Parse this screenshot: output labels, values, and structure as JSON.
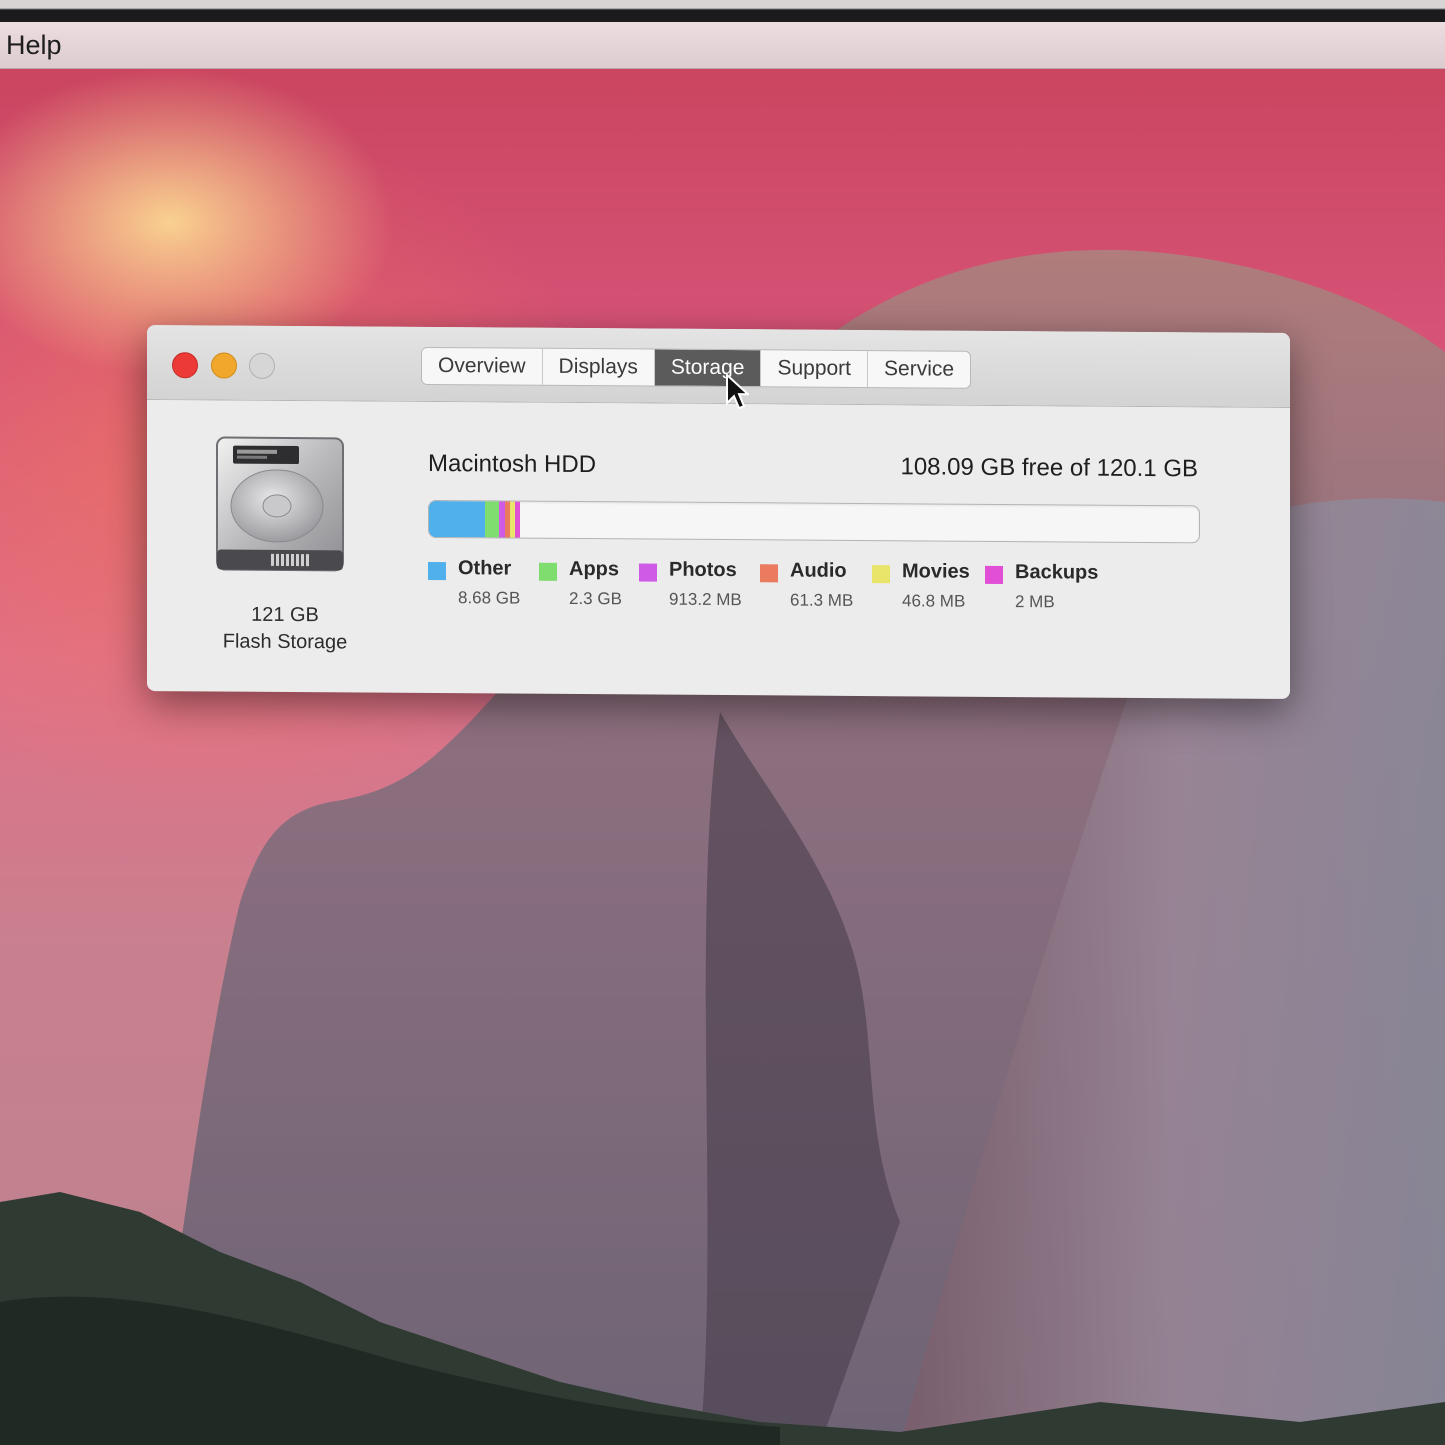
{
  "menubar": {
    "help_label": "Help"
  },
  "window": {
    "tabs": [
      {
        "label": "Overview",
        "active": false
      },
      {
        "label": "Displays",
        "active": false
      },
      {
        "label": "Storage",
        "active": true
      },
      {
        "label": "Support",
        "active": false
      },
      {
        "label": "Service",
        "active": false
      }
    ],
    "disk": {
      "capacity": "121 GB",
      "type": "Flash Storage",
      "icon": "hard-drive-icon"
    },
    "volume": {
      "name": "Macintosh HDD",
      "free_text": "108.09 GB free of 120.1 GB",
      "total_gb": 120.1,
      "free_gb": 108.09
    },
    "categories": [
      {
        "label": "Other",
        "size": "8.68 GB",
        "gb": 8.68,
        "color": "#4fb0ec"
      },
      {
        "label": "Apps",
        "size": "2.3 GB",
        "gb": 2.3,
        "color": "#7fdc6e"
      },
      {
        "label": "Photos",
        "size": "913.2 MB",
        "gb": 0.9132,
        "color": "#cf5ae6"
      },
      {
        "label": "Audio",
        "size": "61.3 MB",
        "gb": 0.0613,
        "color": "#ea7b5f"
      },
      {
        "label": "Movies",
        "size": "46.8 MB",
        "gb": 0.0468,
        "color": "#e9e56a"
      },
      {
        "label": "Backups",
        "size": "2 MB",
        "gb": 0.002,
        "color": "#e04fd6"
      }
    ]
  }
}
